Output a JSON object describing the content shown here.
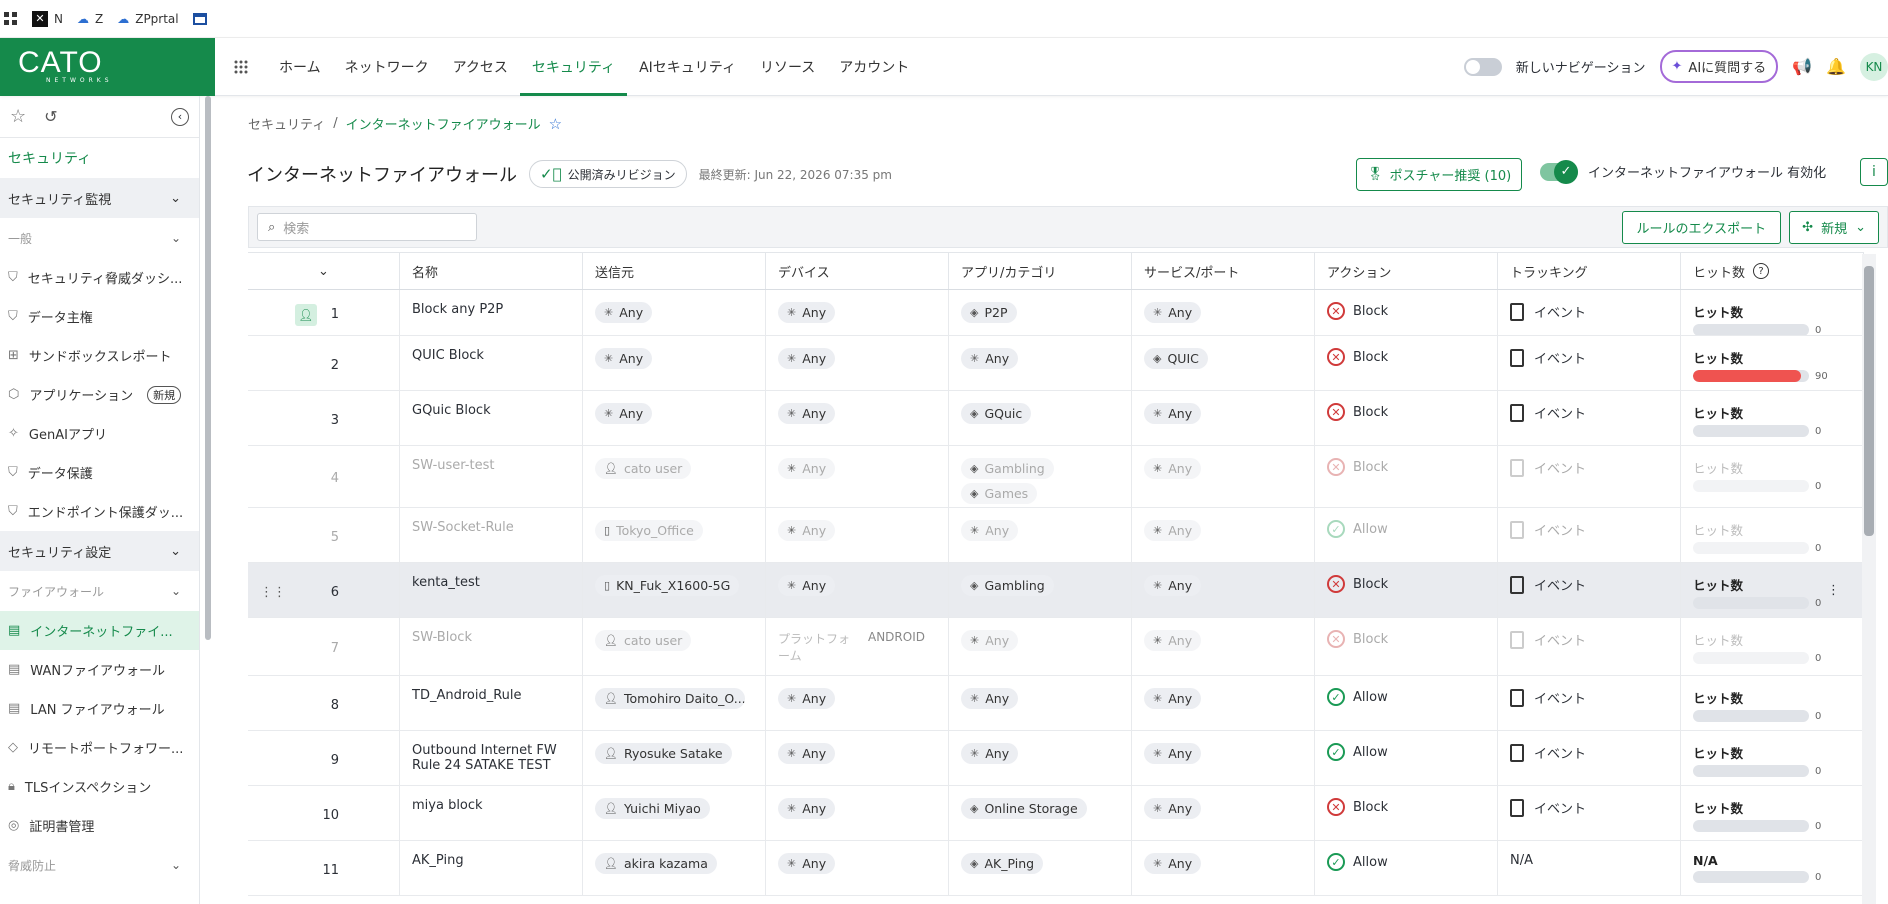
{
  "bookmarks": [
    {
      "label": "",
      "icon": "apps-grid-icon"
    },
    {
      "label": "N",
      "icon": "x-logo-icon"
    },
    {
      "label": "Z",
      "icon": "cloud-icon"
    },
    {
      "label": "ZPprtal",
      "icon": "cloud-icon"
    },
    {
      "label": "",
      "icon": "window-icon"
    }
  ],
  "logo": {
    "main": "CATO",
    "sub": "NETWORKS"
  },
  "nav": {
    "tabs": [
      "ホーム",
      "ネットワーク",
      "アクセス",
      "セキュリティ",
      "AIセキュリティ",
      "リソース",
      "アカウント"
    ],
    "active_index": 3,
    "new_nav_label": "新しいナビゲーション",
    "ai_button": "AIに質問する",
    "avatar": "KN"
  },
  "sidebar": {
    "section_title": "セキュリティ",
    "groups": [
      {
        "label": "セキュリティ監視"
      },
      {
        "label": "セキュリティ設定"
      }
    ],
    "sub_general": "一般",
    "general_items": [
      {
        "label": "セキュリティ脅威ダッシ...",
        "icon": "shield-icon"
      },
      {
        "label": "データ主権",
        "icon": "shield-icon"
      },
      {
        "label": "サンドボックスレポート",
        "icon": "grid-icon"
      },
      {
        "label": "アプリケーション",
        "icon": "cube-icon",
        "badge": "新規"
      },
      {
        "label": "GenAIアプリ",
        "icon": "sparkle-icon"
      },
      {
        "label": "データ保護",
        "icon": "shield-icon"
      },
      {
        "label": "エンドポイント保護ダッ...",
        "icon": "shield-icon"
      }
    ],
    "sub_firewall": "ファイアウォール",
    "firewall_items": [
      {
        "label": "インターネットファイ...",
        "icon": "firewall-icon",
        "active": true
      },
      {
        "label": "WANファイアウォール",
        "icon": "firewall-icon"
      },
      {
        "label": "LAN ファイアウォール",
        "icon": "firewall-icon"
      },
      {
        "label": "リモートポートフォワー...",
        "icon": "diamond-icon"
      },
      {
        "label": "TLSインスペクション",
        "icon": "lock-icon"
      },
      {
        "label": "証明書管理",
        "icon": "check-circle-icon"
      }
    ],
    "sub_threat": "脅威防止"
  },
  "breadcrumb": {
    "parent": "セキュリティ",
    "current": "インターネットファイアウォール"
  },
  "header": {
    "title": "インターネットファイアウォール",
    "published": "公開済みリビジョン",
    "last_updated": "最終更新: Jun 22, 2026 07:35 pm",
    "posture_button": "ポスチャー推奨 (10)",
    "enable_label": "インターネットファイアウォール 有効化"
  },
  "toolbar": {
    "search_placeholder": "検索",
    "export_label": "ルールのエクスポート",
    "new_label": "新規"
  },
  "table": {
    "headers": [
      "",
      "名称",
      "送信元",
      "デバイス",
      "アプリ/カテゴリ",
      "サービス/ポート",
      "アクション",
      "トラッキング",
      "ヒット数"
    ],
    "rows": [
      {
        "num": "1",
        "name": "Block any P2P",
        "source": [
          "Any"
        ],
        "device": [
          "Any"
        ],
        "app": [
          "P2P"
        ],
        "service": [
          "Any"
        ],
        "action": "Block",
        "tracking": "イベント",
        "hits_label": "ヒット数",
        "hits": "0",
        "fill": 0,
        "dim": false,
        "flag": true
      },
      {
        "num": "2",
        "name": "QUIC Block",
        "source": [
          "Any"
        ],
        "device": [
          "Any"
        ],
        "app": [
          "Any"
        ],
        "service": [
          "QUIC"
        ],
        "action": "Block",
        "tracking": "イベント",
        "hits_label": "ヒット数",
        "hits": "90",
        "fill": 0.93,
        "dim": false
      },
      {
        "num": "3",
        "name": "GQuic Block",
        "source": [
          "Any"
        ],
        "device": [
          "Any"
        ],
        "app": [
          "GQuic"
        ],
        "service": [
          "Any"
        ],
        "action": "Block",
        "tracking": "イベント",
        "hits_label": "ヒット数",
        "hits": "0",
        "fill": 0,
        "dim": false
      },
      {
        "num": "4",
        "name": "SW-user-test",
        "source": [
          "cato user"
        ],
        "device": [
          "Any"
        ],
        "app": [
          "Gambling",
          "Games"
        ],
        "service": [
          "Any"
        ],
        "action": "Block",
        "tracking": "イベント",
        "hits_label": "ヒット数",
        "hits": "0",
        "fill": 0,
        "dim": true
      },
      {
        "num": "5",
        "name": "SW-Socket-Rule",
        "source": [
          "Tokyo_Office"
        ],
        "device": [
          "Any"
        ],
        "app": [
          "Any"
        ],
        "service": [
          "Any"
        ],
        "action": "Allow",
        "tracking": "イベント",
        "hits_label": "ヒット数",
        "hits": "0",
        "fill": 0,
        "dim": true
      },
      {
        "num": "6",
        "name": "kenta_test",
        "source": [
          "KN_Fuk_X1600-5G"
        ],
        "device": [
          "Any"
        ],
        "app": [
          "Gambling"
        ],
        "service": [
          "Any"
        ],
        "action": "Block",
        "tracking": "イベント",
        "hits_label": "ヒット数",
        "hits": "0",
        "fill": 0,
        "dim": false,
        "selected": true
      },
      {
        "num": "7",
        "name": "SW-Block",
        "source": [
          "cato user"
        ],
        "device_text": "プラットフォーム",
        "device_extra": "ANDROID",
        "app": [
          "Any"
        ],
        "service": [
          "Any"
        ],
        "action": "Block",
        "tracking": "イベント",
        "hits_label": "ヒット数",
        "hits": "0",
        "fill": 0,
        "dim": true
      },
      {
        "num": "8",
        "name": "TD_Android_Rule",
        "source": [
          "Tomohiro Daito_O..."
        ],
        "device": [
          "Any"
        ],
        "app": [
          "Any"
        ],
        "service": [
          "Any"
        ],
        "action": "Allow",
        "tracking": "イベント",
        "hits_label": "ヒット数",
        "hits": "0",
        "fill": 0,
        "dim": false
      },
      {
        "num": "9",
        "name": "Outbound Internet FW Rule 24 SATAKE TEST",
        "source": [
          "Ryosuke Satake"
        ],
        "device": [
          "Any"
        ],
        "app": [
          "Any"
        ],
        "service": [
          "Any"
        ],
        "action": "Allow",
        "tracking": "イベント",
        "hits_label": "ヒット数",
        "hits": "0",
        "fill": 0,
        "dim": false
      },
      {
        "num": "10",
        "name": "miya block",
        "source": [
          "Yuichi Miyao"
        ],
        "device": [
          "Any"
        ],
        "app": [
          "Online Storage"
        ],
        "service": [
          "Any"
        ],
        "action": "Block",
        "tracking": "イベント",
        "hits_label": "ヒット数",
        "hits": "0",
        "fill": 0,
        "dim": false
      },
      {
        "num": "11",
        "name": "AK_Ping",
        "source": [
          "akira kazama"
        ],
        "device": [
          "Any"
        ],
        "app": [
          "AK_Ping"
        ],
        "service": [
          "Any"
        ],
        "action": "Allow",
        "tracking": "N/A",
        "hits_label": "N/A",
        "hits": "0",
        "fill": 0,
        "dim": false
      }
    ]
  }
}
